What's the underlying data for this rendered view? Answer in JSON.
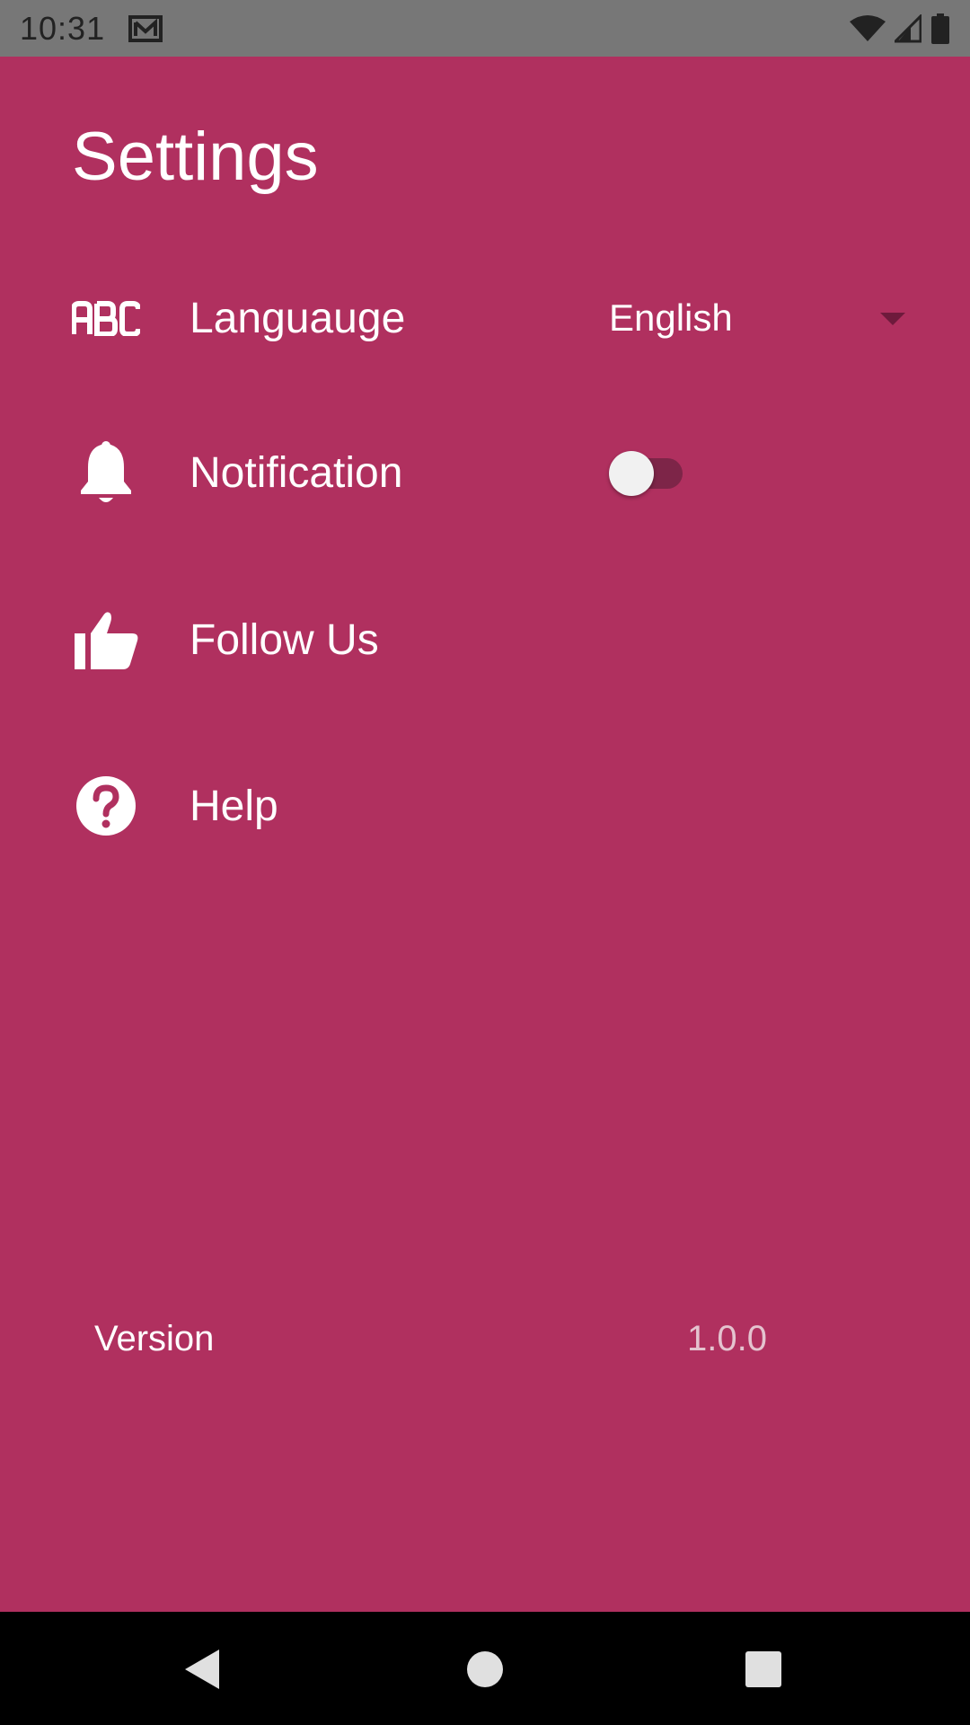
{
  "status_bar": {
    "time": "10:31",
    "icons": [
      "gmail-icon",
      "wifi-icon",
      "signal-icon",
      "battery-icon"
    ]
  },
  "page": {
    "title": "Settings",
    "background_color": "#b0305f"
  },
  "settings": {
    "language": {
      "icon": "abc-icon",
      "label": "Languauge",
      "value": "English"
    },
    "notification": {
      "icon": "bell-icon",
      "label": "Notification",
      "enabled": false
    },
    "follow_us": {
      "icon": "thumbs-up-icon",
      "label": "Follow Us"
    },
    "help": {
      "icon": "help-circle-icon",
      "label": "Help"
    }
  },
  "version": {
    "label": "Version",
    "value": "1.0.0"
  },
  "nav_bar": {
    "buttons": [
      "back-icon",
      "home-icon",
      "recents-icon"
    ]
  }
}
